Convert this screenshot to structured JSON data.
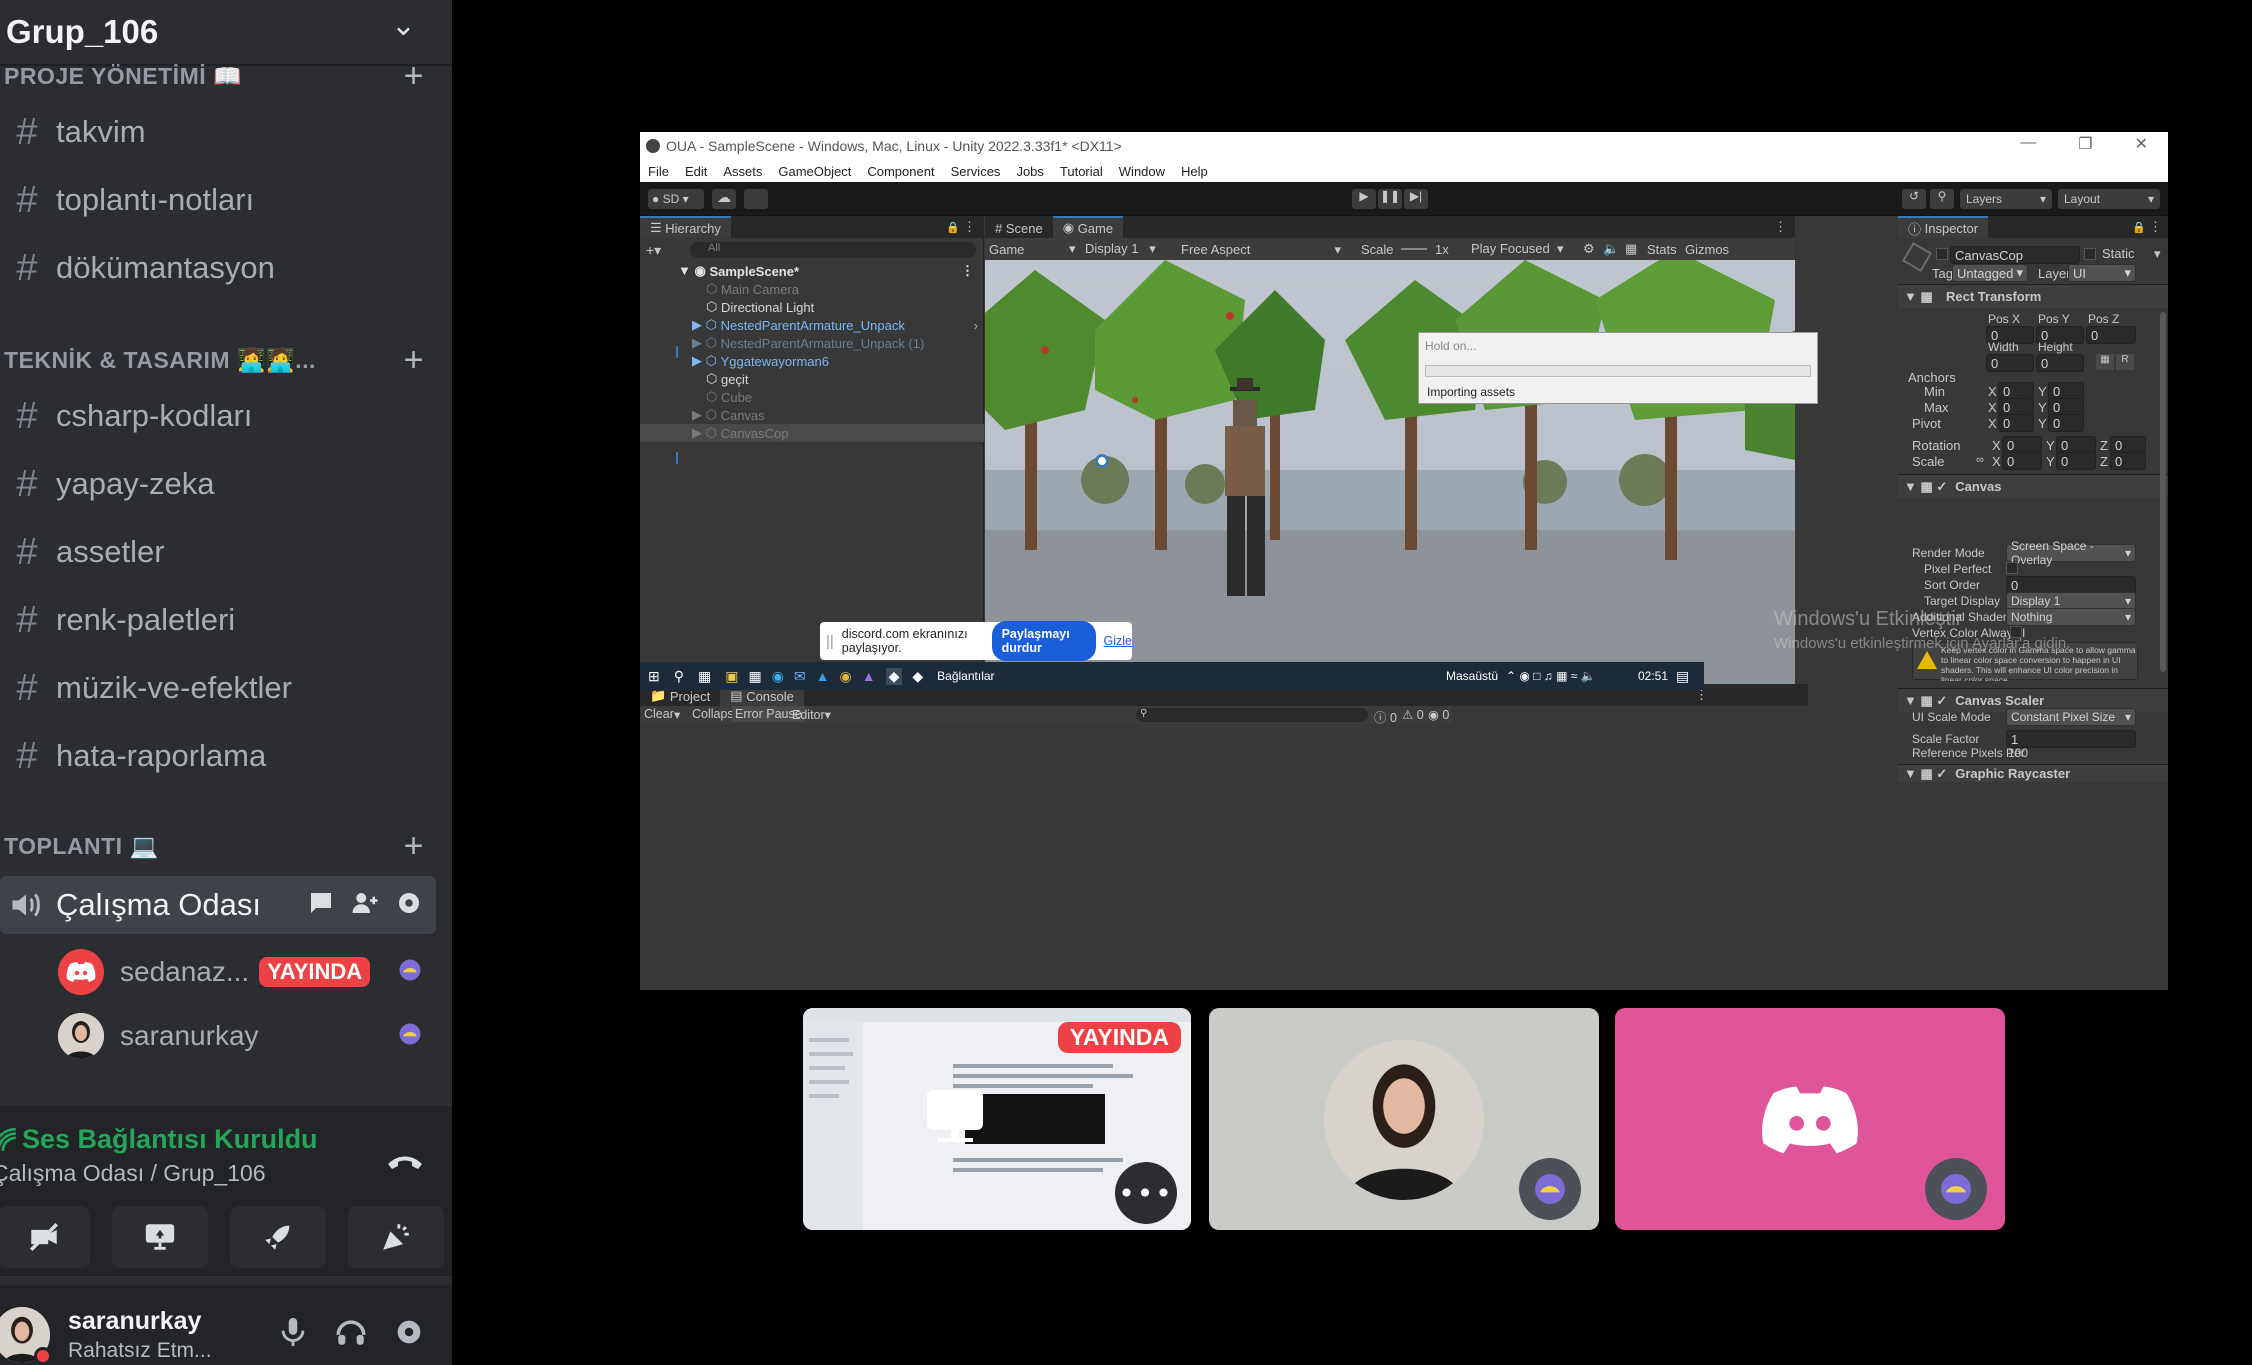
{
  "server": {
    "name": "Grup_106"
  },
  "categories": {
    "proje": "PROJE YÖNETİMİ 📖",
    "teknik": "TEKNİK & TASARIM 👩‍💻🧑‍💻...",
    "toplanti": "TOPLANTI 💻"
  },
  "channels": [
    "takvim",
    "toplantı-notları",
    "dökümantasyon",
    "csharp-kodları",
    "yapay-zeka",
    "assetler",
    "renk-paletleri",
    "müzik-ve-efektler",
    "hata-raporlama"
  ],
  "voice_channel": {
    "name": "Çalışma Odası"
  },
  "voice_users": [
    {
      "name": "sedanaz...",
      "badge": "YAYINDA"
    },
    {
      "name": "saranurkay"
    }
  ],
  "voice_status": {
    "title": "Ses Bağlantısı Kuruldu",
    "subtitle": "Çalışma Odası / Grup_106"
  },
  "user": {
    "name": "saranurkay",
    "status": "Rahatsız Etm..."
  },
  "unity": {
    "title": "OUA - SampleScene - Windows, Mac, Linux - Unity 2022.3.33f1* <DX11>",
    "menu": [
      "File",
      "Edit",
      "Assets",
      "GameObject",
      "Component",
      "Services",
      "Jobs",
      "Tutorial",
      "Window",
      "Help"
    ],
    "toolbar": {
      "account": "SD",
      "layers": "Layers",
      "layout": "Layout"
    },
    "hierarchy": {
      "tab": "Hierarchy",
      "search": "All",
      "items": [
        "SampleScene*",
        "Main Camera",
        "Directional Light",
        "NestedParentArmature_Unpack",
        "NestedParentArmature_Unpack (1)",
        "Yggatewayorman6",
        "geçit",
        "Cube",
        "Canvas",
        "CanvasCop"
      ]
    },
    "view_tabs": [
      "Scene",
      "Game"
    ],
    "game_bar": {
      "mode": "Game",
      "display": "Display 1",
      "aspect": "Free Aspect",
      "scale_label": "Scale",
      "scale": "1x",
      "play": "Play Focused",
      "stats": "Stats",
      "gizmos": "Gizmos"
    },
    "dialog": {
      "title": "Hold on...",
      "message": "Importing assets"
    },
    "bottom_tabs": [
      "Project",
      "Console"
    ],
    "console_bar": {
      "clear": "Clear",
      "collapse": "Collapse",
      "error_pause": "Error Pause",
      "editor": "Editor",
      "c1": "0",
      "c2": "0",
      "c3": "0"
    },
    "inspector": {
      "tab": "Inspector",
      "object": "CanvasCop",
      "static": "Static",
      "tag_label": "Tag",
      "tag": "Untagged",
      "layer_label": "Layer",
      "layer": "UI",
      "rect": "Rect Transform",
      "posx": "Pos X",
      "posy": "Pos Y",
      "posz": "Pos Z",
      "zero": "0",
      "width": "Width",
      "height": "Height",
      "anchors": "Anchors",
      "min": "Min",
      "max": "Max",
      "pivot": "Pivot",
      "rotation": "Rotation",
      "scale": "Scale",
      "x": "X",
      "y": "Y",
      "z": "Z",
      "r": "R",
      "canvas": "Canvas",
      "render_mode_label": "Render Mode",
      "render_mode": "Screen Space - Overlay",
      "pixel_perfect": "Pixel Perfect",
      "sort_order_label": "Sort Order",
      "sort_order": "0",
      "target_display_label": "Target Display",
      "target_display": "Display 1",
      "shader_label": "Additional Shader Ch",
      "shader": "Nothing",
      "vertex_label": "Vertex Color Always I",
      "warning": "Keep vertex color in Gamma space to allow gamma to linear color space conversion to happen in UI shaders. This will enhance UI color precision in linear color space.",
      "scaler": "Canvas Scaler",
      "ui_scale_label": "UI Scale Mode",
      "ui_scale": "Constant Pixel Size",
      "scale_factor_label": "Scale Factor",
      "scale_factor": "1",
      "ref_label": "Reference Pixels Per",
      "ref": "100",
      "raycaster": "Graphic Raycaster"
    },
    "watermark": {
      "line1": "Windows'u Etkinleştir",
      "line2": "Windows'u etkinleştirmek için Ayarlar'a gidin."
    },
    "share": {
      "text": "discord.com ekranınızı paylaşıyor.",
      "stop": "Paylaşmayı durdur",
      "hide": "Gizle"
    },
    "taskbar": {
      "links": "Bağlantılar",
      "desktop": "Masaüstü",
      "time": "02:51"
    }
  },
  "tiles": {
    "live": "YAYINDA"
  },
  "colors": {
    "accent": "#5865f2",
    "live": "#ed4245",
    "connected": "#23a55a",
    "pink": "#e0559a"
  }
}
